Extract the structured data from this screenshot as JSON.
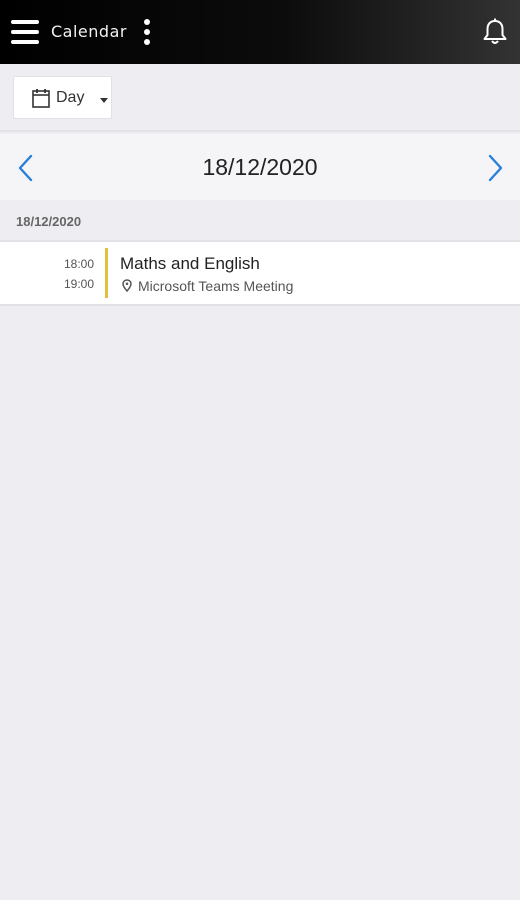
{
  "header": {
    "title": "Calendar",
    "menu_icon": "hamburger-menu-icon",
    "more_icon": "vertical-ellipsis-icon",
    "notifications_icon": "bell-icon"
  },
  "toolbar": {
    "view_selector": {
      "icon": "calendar-icon",
      "label": "Day",
      "caret_icon": "caret-down-icon"
    }
  },
  "date_nav": {
    "current_date": "18/12/2020",
    "prev_icon": "chevron-left-icon",
    "next_icon": "chevron-right-icon",
    "accent_color": "#2a7fd6"
  },
  "agenda": {
    "day_header": "18/12/2020",
    "events": [
      {
        "start": "18:00",
        "end": "19:00",
        "title": "Maths and English",
        "location_icon": "map-pin-icon",
        "location": "Microsoft Teams Meeting",
        "color": "#e2bf3c"
      }
    ]
  }
}
